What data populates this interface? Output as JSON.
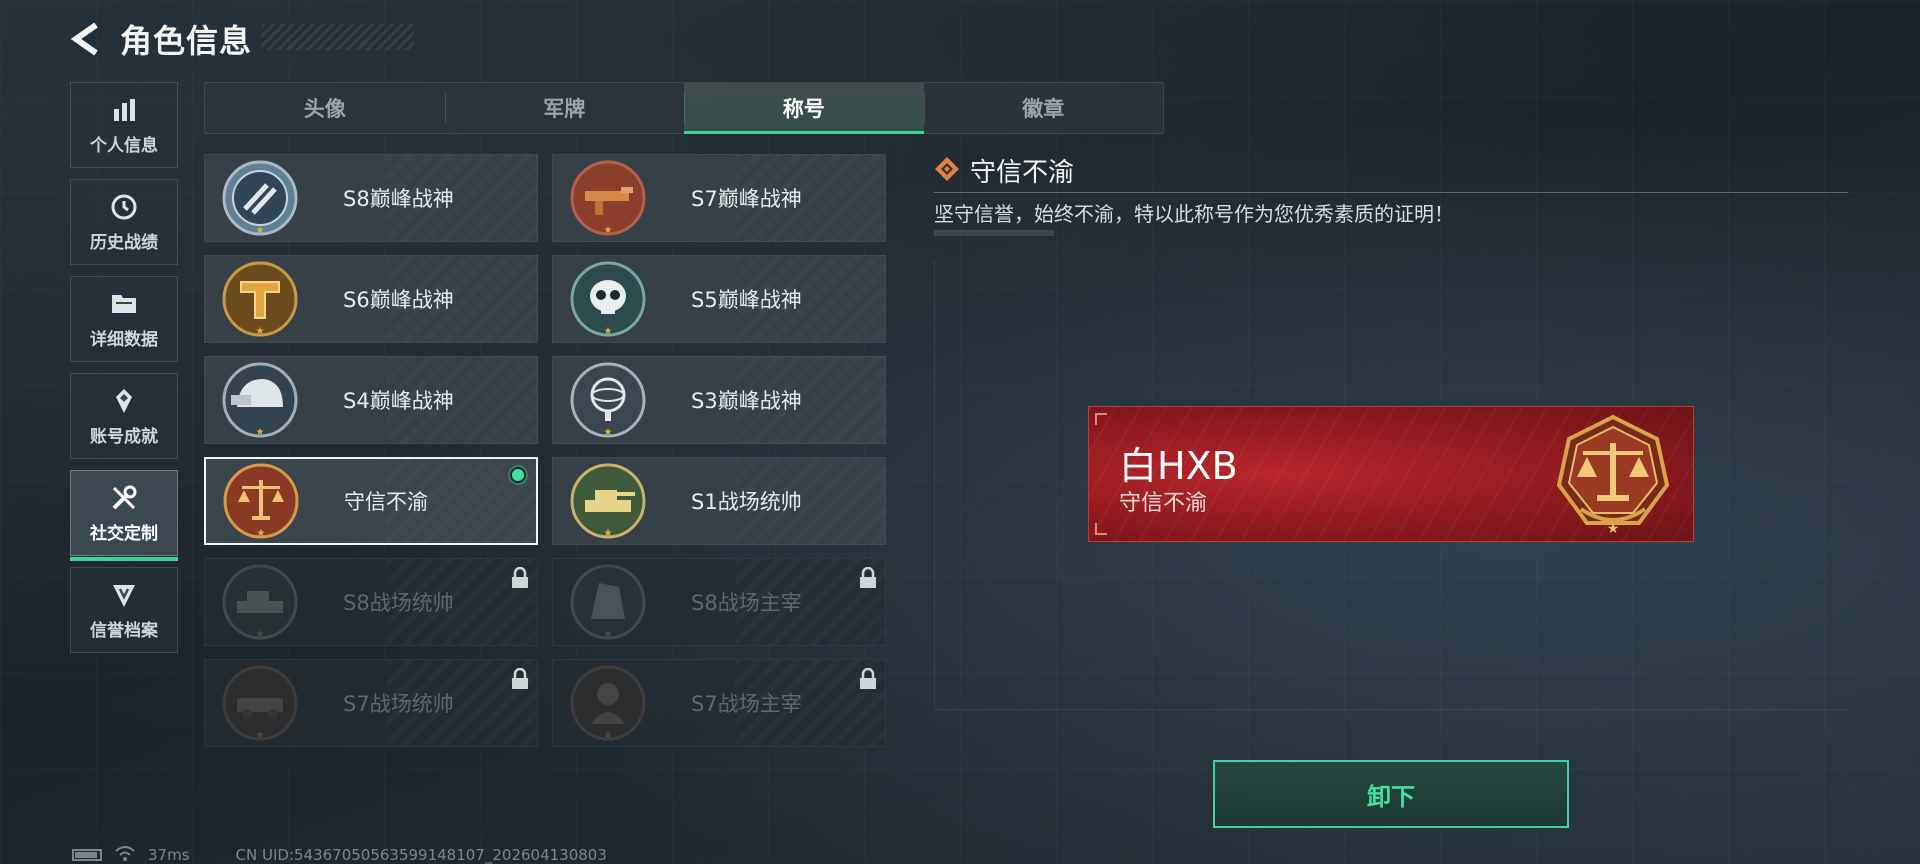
{
  "header": {
    "title": "角色信息"
  },
  "sidebar": {
    "items": [
      {
        "label": "个人信息",
        "icon": "bar-chart-icon",
        "active": false
      },
      {
        "label": "历史战绩",
        "icon": "history-icon",
        "active": false
      },
      {
        "label": "详细数据",
        "icon": "folder-icon",
        "active": false
      },
      {
        "label": "账号成就",
        "icon": "achievement-icon",
        "active": false
      },
      {
        "label": "社交定制",
        "icon": "tools-icon",
        "active": true
      },
      {
        "label": "信誉档案",
        "icon": "shield-rank-icon",
        "active": false
      }
    ]
  },
  "tabs": [
    {
      "label": "头像",
      "active": false
    },
    {
      "label": "军牌",
      "active": false
    },
    {
      "label": "称号",
      "active": true
    },
    {
      "label": "徽章",
      "active": false
    }
  ],
  "titles": [
    {
      "name": "S8巅峰战神",
      "emblem": "blue-stripe-emblem",
      "state": "unlocked"
    },
    {
      "name": "S7巅峰战神",
      "emblem": "gun-emblem",
      "state": "unlocked"
    },
    {
      "name": "S6巅峰战神",
      "emblem": "gold-t-emblem",
      "state": "unlocked"
    },
    {
      "name": "S5巅峰战神",
      "emblem": "skull-emblem",
      "state": "unlocked"
    },
    {
      "name": "S4巅峰战神",
      "emblem": "helmet-emblem",
      "state": "unlocked"
    },
    {
      "name": "S3巅峰战神",
      "emblem": "globe-emblem",
      "state": "unlocked"
    },
    {
      "name": "守信不渝",
      "emblem": "scales-emblem",
      "state": "equipped"
    },
    {
      "name": "S1战场统帅",
      "emblem": "tank-emblem",
      "state": "unlocked"
    },
    {
      "name": "S8战场统帅",
      "emblem": "tank-emblem",
      "state": "locked"
    },
    {
      "name": "S8战场主宰",
      "emblem": "building-emblem",
      "state": "locked"
    },
    {
      "name": "S7战场统帅",
      "emblem": "vehicle-emblem",
      "state": "locked"
    },
    {
      "name": "S7战场主宰",
      "emblem": "soldier-emblem",
      "state": "locked"
    }
  ],
  "detail": {
    "title": "守信不渝",
    "description": "坚守信誉，始终不渝，特以此称号作为您优秀素质的证明！"
  },
  "nameplate": {
    "player_name": "白HXB",
    "title": "守信不渝"
  },
  "actions": {
    "unequip_label": "卸下"
  },
  "status_bar": {
    "latency": "37ms",
    "uid": "CN UID:54367050563599148107_202604130803"
  },
  "colors": {
    "accent": "#3fd39a",
    "plate_red": "#8e1a1f",
    "gold": "#d9a445"
  }
}
